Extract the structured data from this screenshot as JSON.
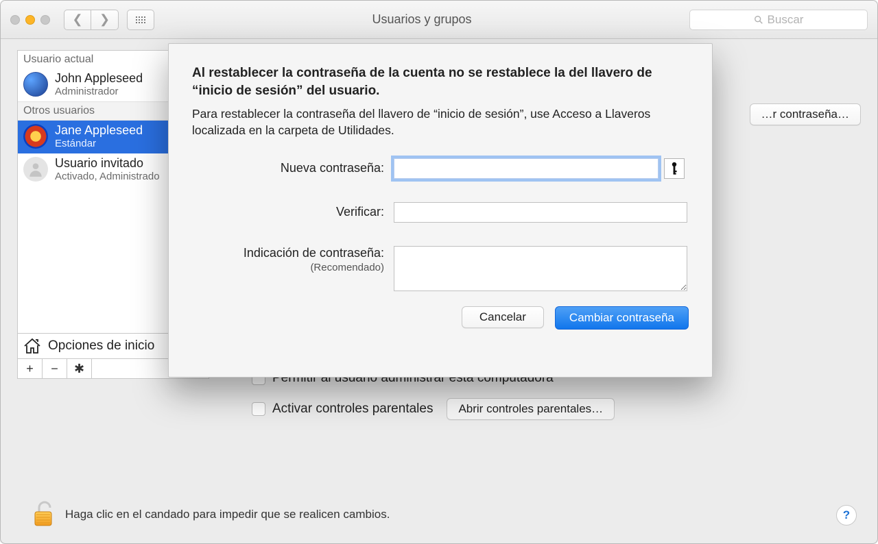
{
  "window": {
    "title": "Usuarios y grupos",
    "search_placeholder": "Buscar"
  },
  "sidebar": {
    "current_section": "Usuario actual",
    "others_section": "Otros usuarios",
    "login_options": "Opciones de inicio",
    "current_user": {
      "name": "John Appleseed",
      "role": "Administrador"
    },
    "other_users": [
      {
        "name": "Jane Appleseed",
        "role": "Estándar"
      },
      {
        "name": "Usuario invitado",
        "role": "Activado, Administrado"
      }
    ]
  },
  "right": {
    "reset_btn": "…r contraseña…",
    "allow_admin": "Permitir al usuario administrar esta computadora",
    "enable_parental": "Activar controles parentales",
    "open_parental": "Abrir controles parentales…"
  },
  "lock": {
    "message": "Haga clic en el candado para impedir que se realicen cambios."
  },
  "sheet": {
    "headline": "Al restablecer la contraseña de la cuenta no se restablece la del llavero de “inicio de sesión” del usuario.",
    "subtext": "Para restablecer la contraseña del llavero de “inicio de sesión”, use Acceso a Llaveros localizada en la carpeta de Utilidades.",
    "new_password": "Nueva contraseña:",
    "verify": "Verificar:",
    "hint": "Indicación de contraseña:",
    "recommended": "(Recomendado)",
    "cancel": "Cancelar",
    "change": "Cambiar contraseña"
  }
}
